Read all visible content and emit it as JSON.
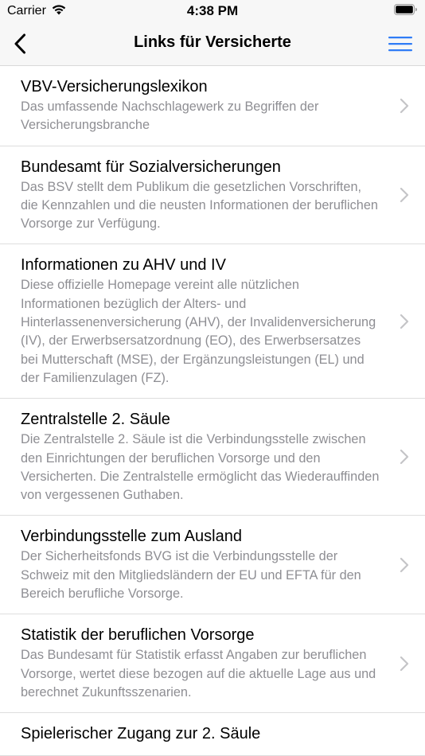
{
  "status_bar": {
    "carrier": "Carrier",
    "time": "4:38 PM"
  },
  "nav": {
    "title": "Links für Versicherte",
    "back_icon": "chevron-left-icon",
    "menu_icon": "hamburger-menu-icon",
    "accent_color": "#2f7cf6"
  },
  "items": [
    {
      "title": "VBV-Versicherungslexikon",
      "description": "Das umfassende Nachschlagewerk zu Begriffen der Versicherungsbranche"
    },
    {
      "title": "Bundesamt für Sozialversicherungen",
      "description": "Das BSV stellt dem Publikum die gesetzlichen Vorschriften, die Kennzahlen und die neusten Informationen der beruflichen Vorsorge zur Verfügung."
    },
    {
      "title": "Informationen zu AHV und IV",
      "description": "Diese offizielle Homepage vereint alle nützlichen Informationen bezüglich der Alters- und Hinterlassenenversicherung (AHV), der Invalidenversicherung (IV), der Erwerbsersatzordnung (EO), des Erwerbsersatzes bei Mutterschaft (MSE), der Ergänzungsleistungen (EL) und der Familienzulagen (FZ)."
    },
    {
      "title": "Zentralstelle 2. Säule",
      "description": "Die Zentralstelle 2. Säule ist die Verbindungsstelle zwischen den Einrichtungen der beruflichen Vorsorge und den Versicherten. Die Zentralstelle ermöglicht das Wiederauffinden von vergessenen Guthaben."
    },
    {
      "title": "Verbindungsstelle zum Ausland",
      "description": "Der Sicherheitsfonds BVG ist die Verbindungsstelle der Schweiz mit den Mitgliedsländern der EU und EFTA für den Bereich berufliche Vorsorge."
    },
    {
      "title": "Statistik der beruflichen Vorsorge",
      "description": "Das Bundesamt für Statistik erfasst Angaben zur beruflichen Vorsorge, wertet diese bezogen auf die aktuelle Lage aus und berechnet Zukunftsszenarien."
    },
    {
      "title": "Spielerischer Zugang zur 2. Säule",
      "description": ""
    }
  ]
}
